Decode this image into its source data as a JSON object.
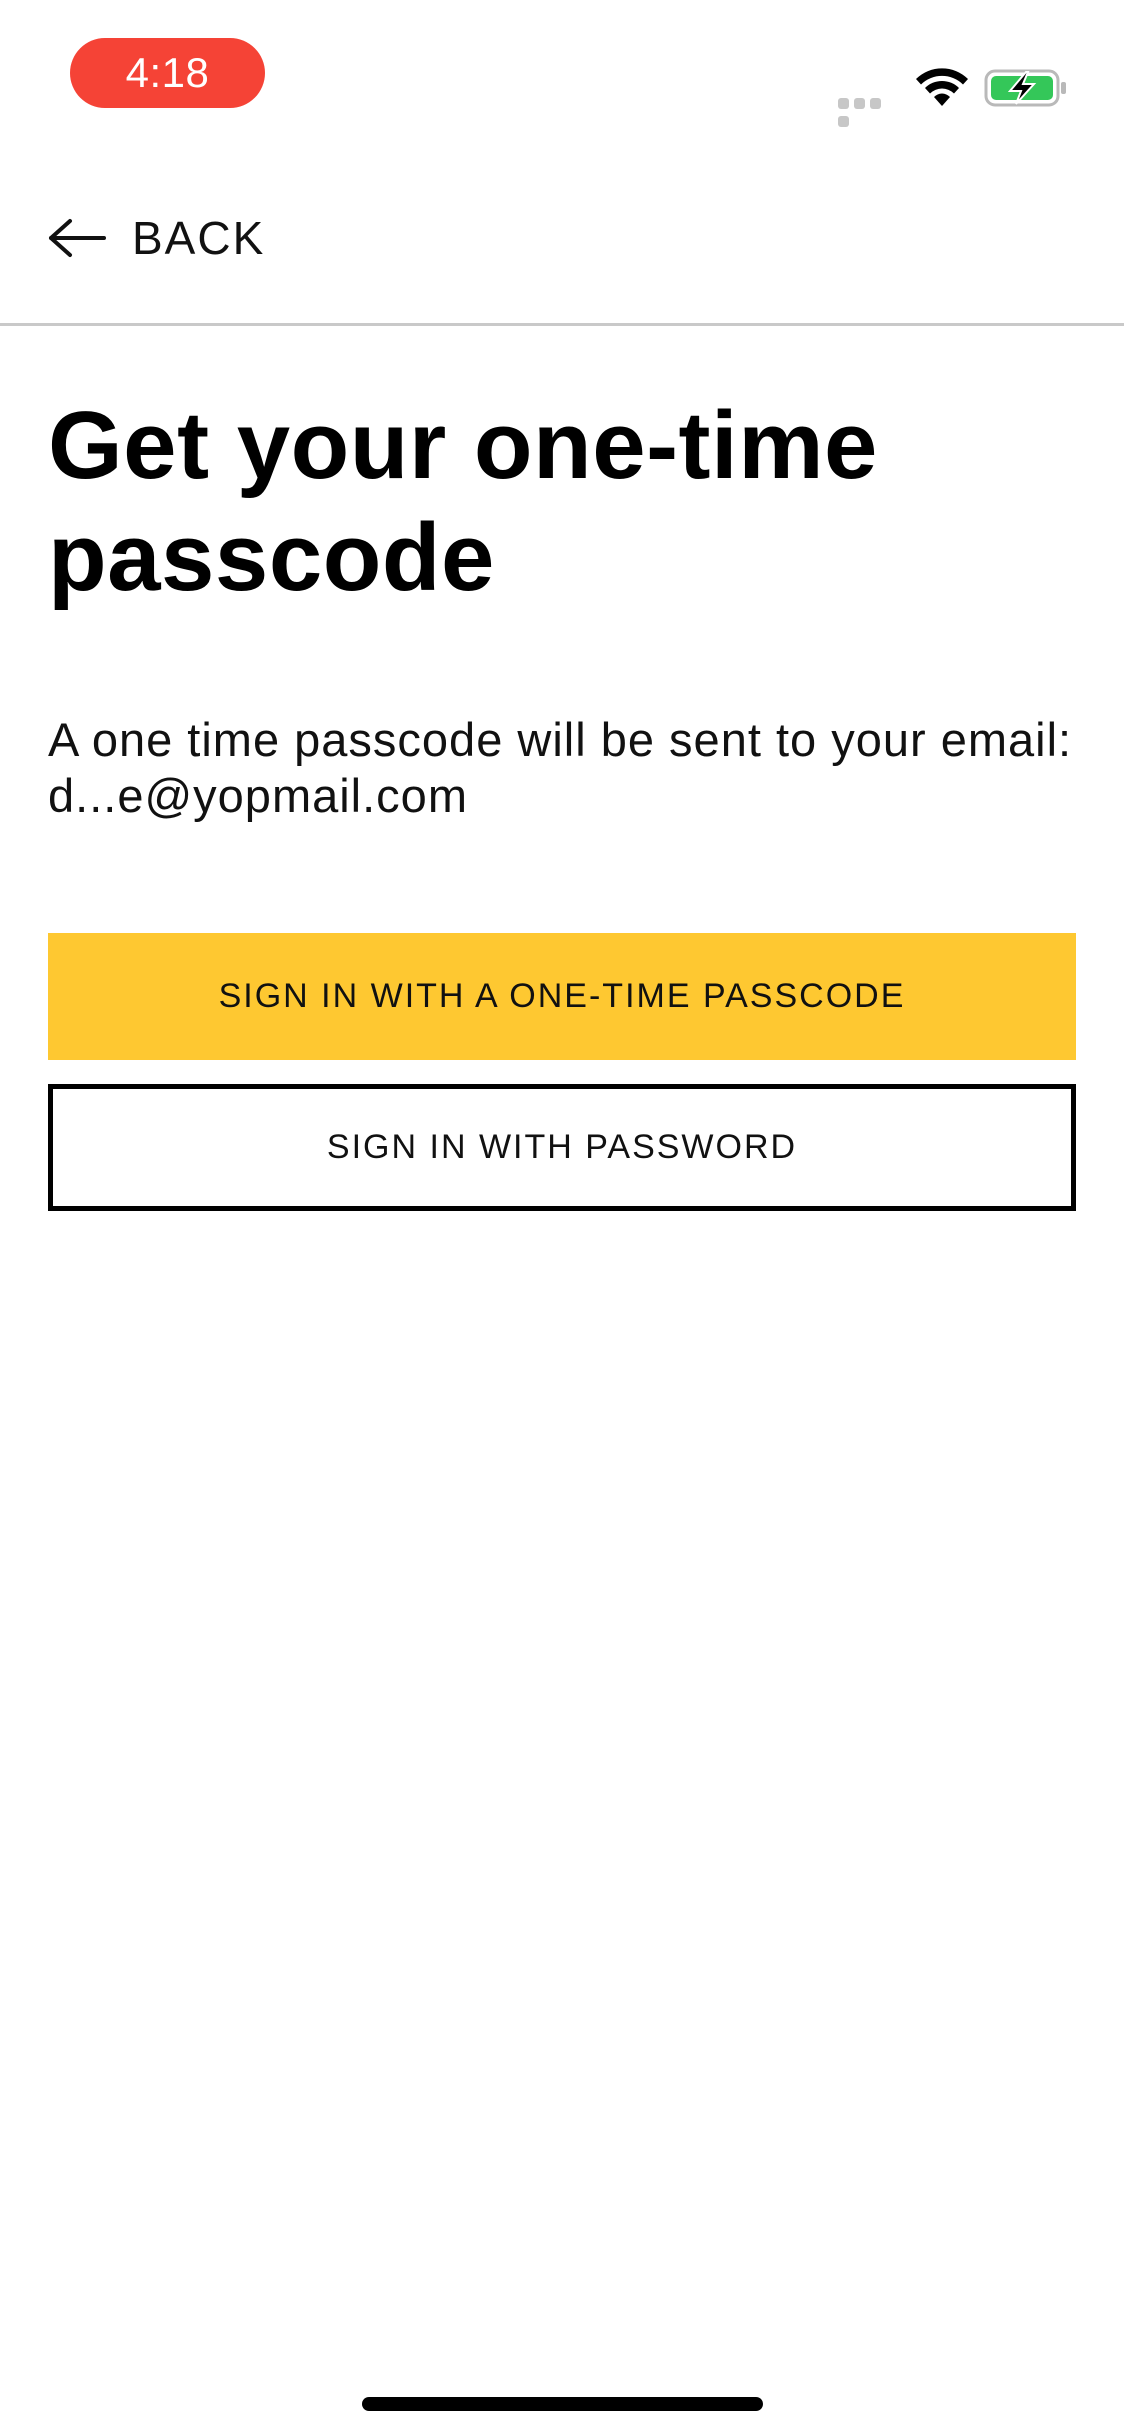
{
  "status_bar": {
    "time": "4:18",
    "signal_icon": "cellular-signal-icon",
    "wifi_icon": "wifi-icon",
    "battery_icon": "battery-charging-icon",
    "time_pill_color": "#f54336",
    "battery_color": "#34c759"
  },
  "nav": {
    "back_label": "BACK",
    "back_icon": "arrow-left-icon"
  },
  "main": {
    "title": "Get your one-time passcode",
    "description": "A one time passcode will be sent to your email: d...e@yopmail.com",
    "primary_button_label": "SIGN IN WITH A ONE-TIME PASSCODE",
    "secondary_button_label": "SIGN IN WITH PASSWORD",
    "accent_color": "#fec831"
  }
}
